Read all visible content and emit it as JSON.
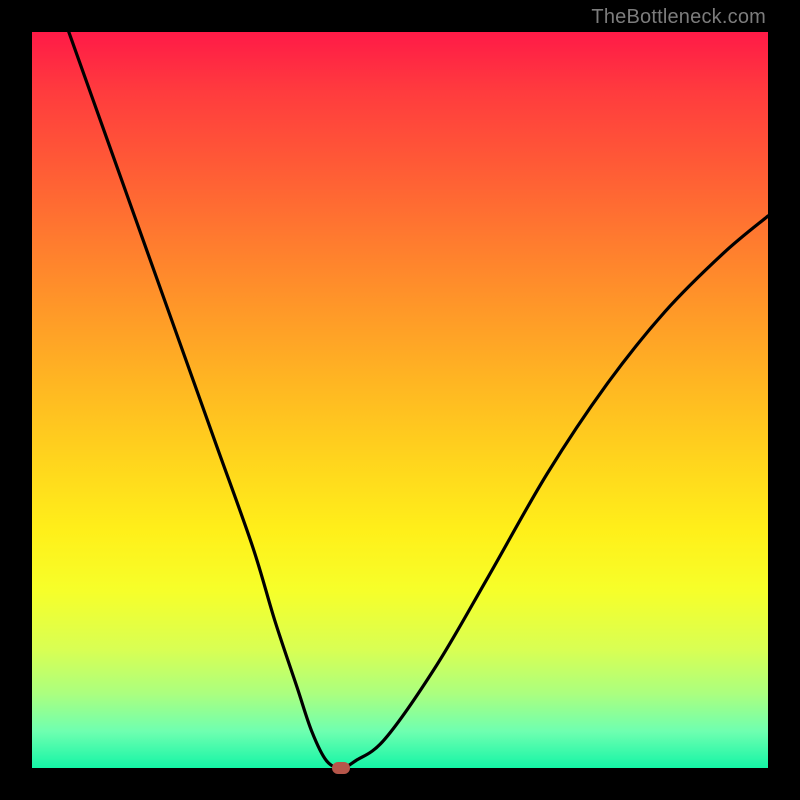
{
  "watermark": "TheBottleneck.com",
  "chart_data": {
    "type": "line",
    "title": "",
    "xlabel": "",
    "ylabel": "",
    "xlim": [
      0,
      100
    ],
    "ylim": [
      0,
      100
    ],
    "grid": false,
    "legend": "none",
    "series": [
      {
        "name": "bottleneck-curve",
        "x": [
          5,
          10,
          15,
          20,
          25,
          30,
          33,
          36,
          38,
          40,
          42,
          44,
          48,
          55,
          62,
          70,
          78,
          86,
          94,
          100
        ],
        "y": [
          100,
          86,
          72,
          58,
          44,
          30,
          20,
          11,
          5,
          1,
          0,
          1,
          4,
          14,
          26,
          40,
          52,
          62,
          70,
          75
        ]
      }
    ],
    "marker": {
      "x": 42,
      "y": 0,
      "label": "optimal-point"
    },
    "gradient_stops": [
      {
        "pos": 0,
        "color": "#ff1a47"
      },
      {
        "pos": 50,
        "color": "#ffd41d"
      },
      {
        "pos": 100,
        "color": "#14f5a6"
      }
    ]
  }
}
